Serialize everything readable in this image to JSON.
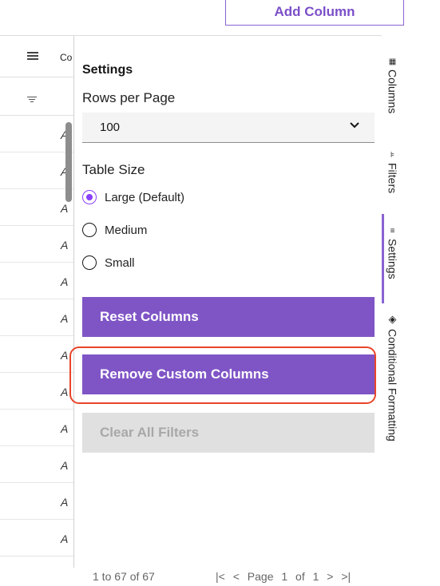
{
  "toolbar": {
    "add_column_label": "Add Column"
  },
  "grid": {
    "header_text": "Co",
    "row_glyph": "A"
  },
  "settings": {
    "title": "Settings",
    "rows_per_page_label": "Rows per Page",
    "rows_per_page_value": "100",
    "table_size_label": "Table Size",
    "size_options": [
      {
        "label": "Large (Default)",
        "selected": true
      },
      {
        "label": "Medium",
        "selected": false
      },
      {
        "label": "Small",
        "selected": false
      }
    ],
    "reset_columns_label": "Reset Columns",
    "remove_custom_columns_label": "Remove Custom Columns",
    "clear_all_filters_label": "Clear All Filters"
  },
  "side_tabs": [
    {
      "label": "Columns",
      "icon": "columns-icon"
    },
    {
      "label": "Filters",
      "icon": "filter-icon"
    },
    {
      "label": "Settings",
      "icon": "settings-icon",
      "active": true
    },
    {
      "label": "Conditional Formatting",
      "icon": "paint-bucket-icon"
    }
  ],
  "footer": {
    "row_count": "1 to 67 of 67",
    "page_text": "Page 1 of 1"
  },
  "colors": {
    "primary_button": "#7f55c6",
    "radio_selected": "#8a3ffc",
    "highlight_outline": "#e8452a",
    "disabled_button": "#e0e0e0"
  }
}
